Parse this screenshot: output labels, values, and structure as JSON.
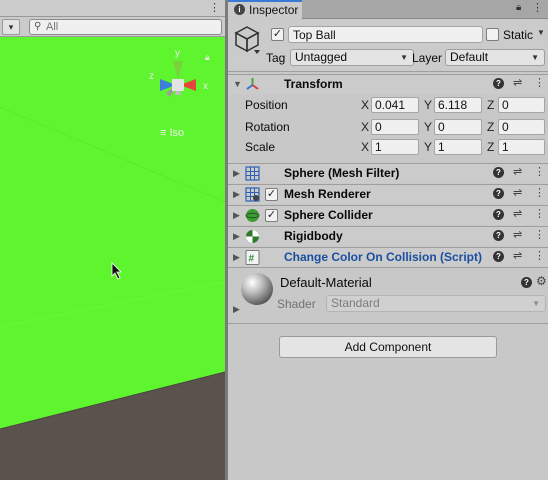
{
  "scene": {
    "search_placeholder": "All",
    "view_mode_label": "Iso",
    "gizmo_axes": {
      "x": "x",
      "y": "y",
      "z": "z"
    },
    "colors": {
      "ground": "#5ef52e",
      "ground_edge": "#4dd81f",
      "floor": "#5a534d",
      "sky": "#4f8fd1"
    }
  },
  "inspector": {
    "tab_label": "Inspector",
    "object": {
      "name": "Top Ball",
      "active": true,
      "static_label": "Static",
      "static": false,
      "tag_label": "Tag",
      "tag_value": "Untagged",
      "layer_label": "Layer",
      "layer_value": "Default"
    },
    "transform": {
      "label": "Transform",
      "rows": [
        {
          "label": "Position",
          "x": "0.041",
          "y": "6.118",
          "z": "0"
        },
        {
          "label": "Rotation",
          "x": "0",
          "y": "0",
          "z": "0"
        },
        {
          "label": "Scale",
          "x": "1",
          "y": "1",
          "z": "1"
        }
      ],
      "axis_labels": {
        "x": "X",
        "y": "Y",
        "z": "Z"
      }
    },
    "components": [
      {
        "label": "Sphere (Mesh Filter)",
        "icon": "mesh-filter-icon",
        "has_checkbox": false
      },
      {
        "label": "Mesh Renderer",
        "icon": "mesh-renderer-icon",
        "has_checkbox": true
      },
      {
        "label": "Sphere Collider",
        "icon": "sphere-collider-icon",
        "has_checkbox": true
      },
      {
        "label": "Rigidbody",
        "icon": "rigidbody-icon",
        "has_checkbox": false
      },
      {
        "label": "Change Color On Collision (Script)",
        "icon": "script-icon",
        "has_checkbox": false
      }
    ],
    "material": {
      "name": "Default-Material",
      "shader_label": "Shader",
      "shader_value": "Standard"
    },
    "add_component_label": "Add Component",
    "colors": {
      "script_link": "#1a4fa0",
      "accent_tab": "#3a79d6",
      "panel": "#c8c8c8"
    }
  }
}
